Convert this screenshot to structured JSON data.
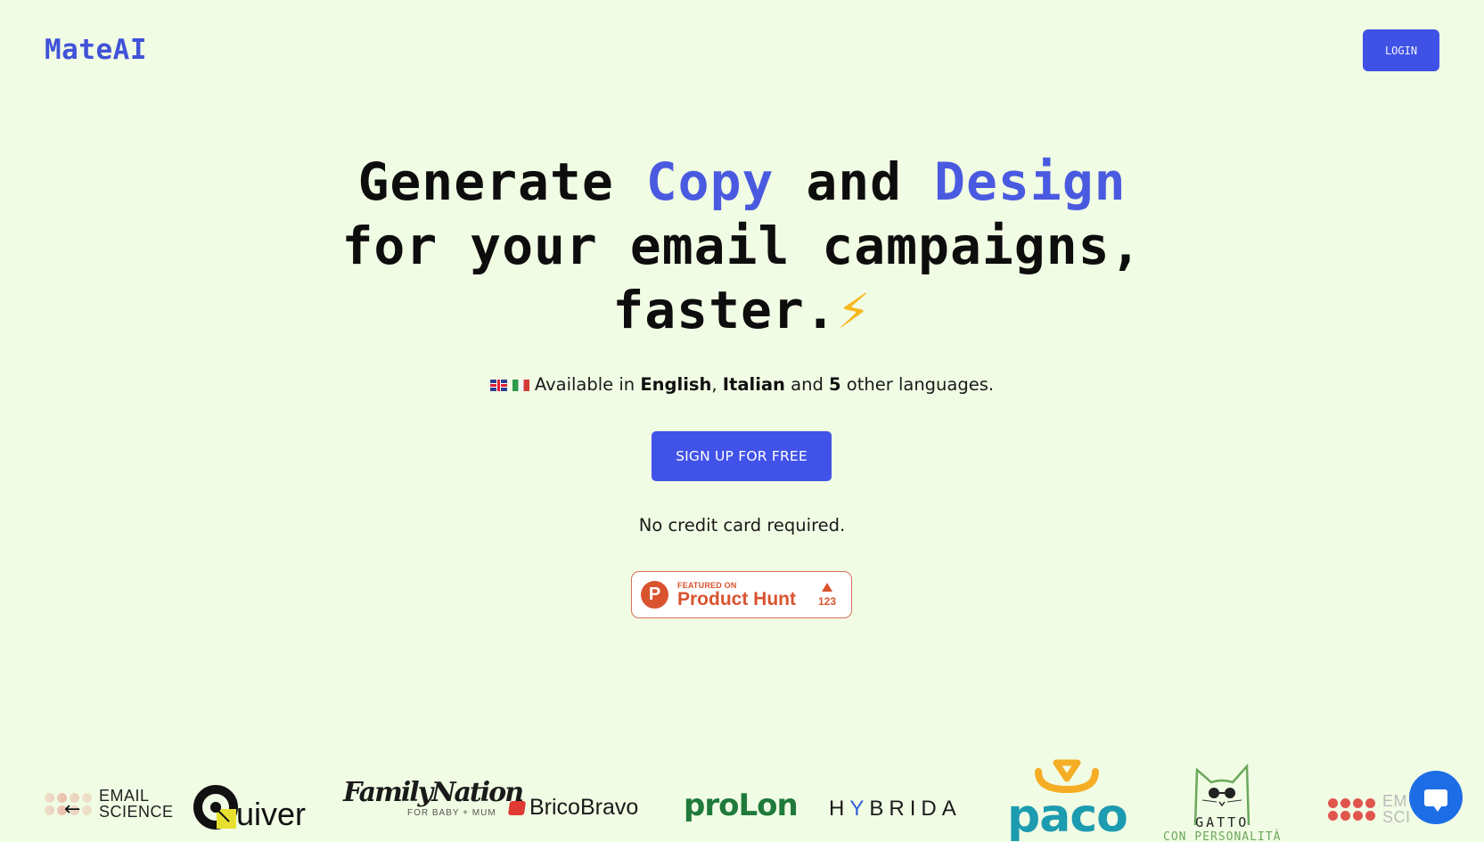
{
  "header": {
    "logo": "MateAI",
    "login_label": "LOGIN"
  },
  "hero": {
    "headline_part1": "Generate ",
    "headline_highlight1": "Copy",
    "headline_part2": " and ",
    "headline_highlight2": "Design",
    "headline_line2": "for your email campaigns,",
    "headline_line3": "faster.",
    "bolt_icon": "⚡",
    "languages": {
      "prefix": "Available in ",
      "lang1": "English",
      "sep": ", ",
      "lang2": "Italian",
      "mid": " and ",
      "count": "5",
      "suffix": " other languages."
    },
    "cta_label": "SIGN UP FOR FREE",
    "note": "No credit card required."
  },
  "product_hunt": {
    "letter": "P",
    "featured_on": "FEATURED ON",
    "name": "Product Hunt",
    "votes": "123"
  },
  "logos": {
    "brands": [
      {
        "name": "email-science",
        "line1": "EMAIL",
        "line2": "SCIENCE"
      },
      {
        "name": "quiver",
        "text": "uiver"
      },
      {
        "name": "familynation",
        "text": "FamilyNation",
        "sub": "FOR BABY + MUM"
      },
      {
        "name": "bricobravo",
        "text": "BricoBravo"
      },
      {
        "name": "prolon",
        "text": "proLon"
      },
      {
        "name": "hybrida",
        "text": "HYBRIDA"
      },
      {
        "name": "paco",
        "text": "paco"
      },
      {
        "name": "gatto",
        "text": "GATTO",
        "sub": "CON PERSONALITÀ"
      },
      {
        "name": "email-science-repeat",
        "line1": "EM",
        "line2": "SCI"
      }
    ],
    "prev_arrow": "←"
  },
  "colors": {
    "background": "#f1fce4",
    "accent": "#4052e5",
    "headline_highlight": "#4a5ae0",
    "product_hunt": "#d9532f",
    "chat": "#1d6ee6"
  }
}
